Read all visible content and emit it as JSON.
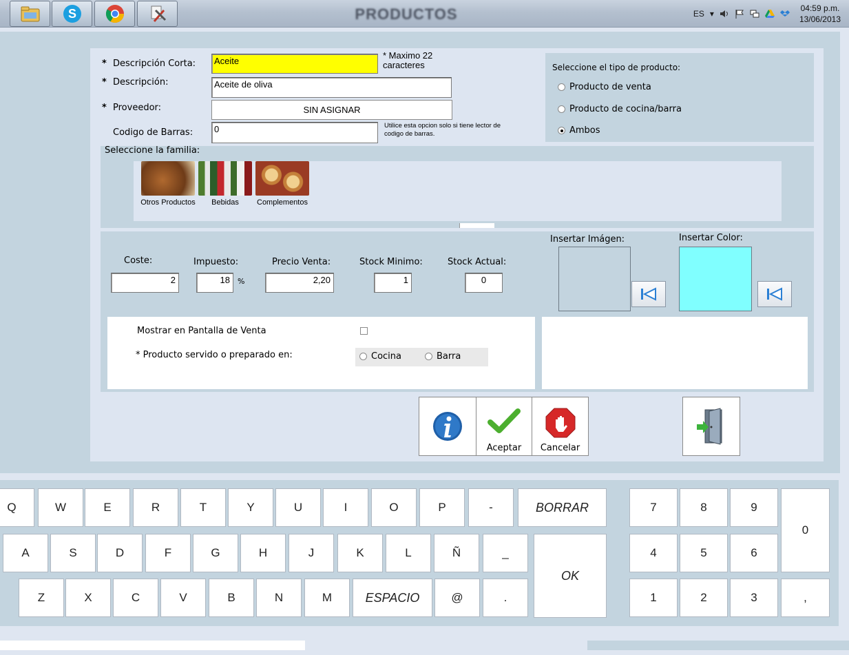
{
  "taskbar": {
    "title": "PRODUCTOS",
    "apps": [
      {
        "icon": "file-explorer-icon"
      },
      {
        "icon": "skype-icon"
      },
      {
        "icon": "chrome-icon"
      },
      {
        "icon": "tools-icon"
      }
    ],
    "language": "ES",
    "time": "04:59 p.m.",
    "date": "13/06/2013"
  },
  "form": {
    "short_desc_label": "Descripción Corta:",
    "short_desc_value": "Aceite",
    "max_note": "* Maximo 22 caracteres",
    "desc_label": "Descripción:",
    "desc_value": "Aceite de oliva",
    "supplier_label": "Proveedor:",
    "supplier_value": "SIN ASIGNAR",
    "barcode_label": "Codigo de Barras:",
    "barcode_value": "0",
    "barcode_note": "Utilice esta opcion solo si tiene lector de codigo de barras.",
    "required_mark": "*"
  },
  "product_type": {
    "title": "Seleccione el tipo de producto:",
    "options": [
      "Producto de venta",
      "Producto de cocina/barra",
      "Ambos"
    ],
    "selected": "Ambos"
  },
  "family": {
    "title": "Seleccione la familia:",
    "items": [
      {
        "label": "Otros Productos",
        "color": "#9a5a2a"
      },
      {
        "label": "Bebidas",
        "color": "#6c8f3f"
      },
      {
        "label": "Complementos",
        "color": "#c98a3e"
      }
    ]
  },
  "pricing": {
    "cost_label": "Coste:",
    "cost_value": "2",
    "tax_label": "Impuesto:",
    "tax_value": "18",
    "tax_unit": "%",
    "price_label": "Precio Venta:",
    "price_value": "2,20",
    "stock_min_label": "Stock Minimo:",
    "stock_min_value": "1",
    "stock_cur_label": "Stock Actual:",
    "stock_cur_value": "0",
    "image_label": "Insertar Imágen:",
    "color_label": "Insertar Color:",
    "color_value": "#80ffff"
  },
  "options": {
    "show_label": "Mostrar en Pantalla de Venta",
    "served_label": "* Producto servido o preparado en:",
    "kitchen": "Cocina",
    "bar": "Barra"
  },
  "actions": {
    "info_icon": "info-icon",
    "accept": "Aceptar",
    "cancel": "Cancelar",
    "exit_icon": "exit-door-icon"
  },
  "keyboard": {
    "row1": [
      "Q",
      "W",
      "E",
      "R",
      "T",
      "Y",
      "U",
      "I",
      "O",
      "P",
      "-"
    ],
    "row2": [
      "A",
      "S",
      "D",
      "F",
      "G",
      "H",
      "J",
      "K",
      "L",
      "Ñ",
      "_"
    ],
    "row3": [
      "Z",
      "X",
      "C",
      "V",
      "B",
      "N",
      "M"
    ],
    "space": "ESPACIO",
    "at": "@",
    "dot": ".",
    "backspace": "BORRAR",
    "ok": "OK",
    "numpad": [
      "7",
      "8",
      "9",
      "4",
      "5",
      "6",
      "1",
      "2",
      "3"
    ],
    "zero": "0",
    "comma": ","
  }
}
